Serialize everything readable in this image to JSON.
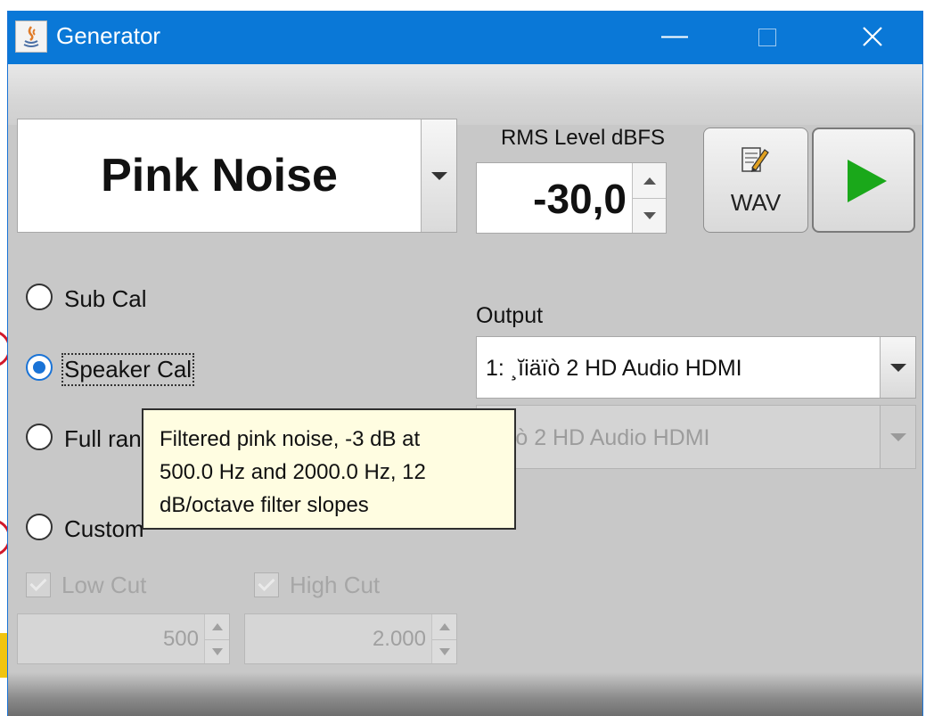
{
  "window": {
    "title": "Generator"
  },
  "signal": {
    "selected": "Pink Noise"
  },
  "rms": {
    "label": "RMS Level dBFS",
    "value": "-30,0"
  },
  "toolbar": {
    "wav_label": "WAV"
  },
  "modes": [
    {
      "label": "Sub Cal",
      "checked": false
    },
    {
      "label": "Speaker Cal",
      "checked": true
    },
    {
      "label": "Full ran",
      "checked": false
    },
    {
      "label": "Custom",
      "checked": false
    }
  ],
  "output": {
    "label": "Output",
    "device": "1: ¸ĭiäïò 2 HD Audio HDMI",
    "device2": "ĭiäïò 2 HD Audio HDMI"
  },
  "filters": {
    "low_cut_label": "Low Cut",
    "high_cut_label": "High Cut",
    "low_cut_value": "500",
    "high_cut_value": "2.000"
  },
  "tooltip": {
    "line1": "Filtered pink noise, -3 dB at",
    "line2": "500.0 Hz and 2000.0 Hz, 12",
    "line3": "dB/octave filter slopes"
  },
  "colors": {
    "titlebar": "#0a78d7",
    "accent": "#1a73d6",
    "play": "#1aa81a",
    "tooltip_bg": "#fffde1"
  }
}
